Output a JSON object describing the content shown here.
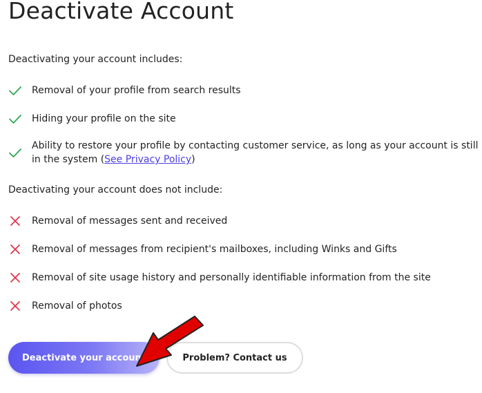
{
  "page": {
    "title": "Deactivate Account"
  },
  "includes": {
    "heading": "Deactivating your account includes:",
    "items": [
      {
        "text": "Removal of your profile from search results"
      },
      {
        "text": "Hiding your profile on the site"
      },
      {
        "text_before": "Ability to restore your profile by contacting customer service, as long as your account is still in the system (",
        "link": "See Privacy Policy",
        "text_after": ")"
      }
    ],
    "icon": "checkmark-icon",
    "icon_color": "#2fa84f"
  },
  "excludes": {
    "heading": "Deactivating your account does not include:",
    "items": [
      {
        "text": "Removal of messages sent and received"
      },
      {
        "text": "Removal of messages from recipient's mailboxes, including Winks and Gifts"
      },
      {
        "text": "Removal of site usage history and personally identifiable information from the site"
      },
      {
        "text": "Removal of photos"
      }
    ],
    "icon": "x-mark-icon",
    "icon_color": "#e0364b"
  },
  "actions": {
    "deactivate_label": "Deactivate your account",
    "contact_label": "Problem? Contact us",
    "primary_gradient_start": "#5b55f0",
    "primary_gradient_end": "#b7b4f8"
  },
  "annotation": {
    "arrow_color": "#e00000",
    "arrow_icon": "red-arrow-annotation"
  }
}
